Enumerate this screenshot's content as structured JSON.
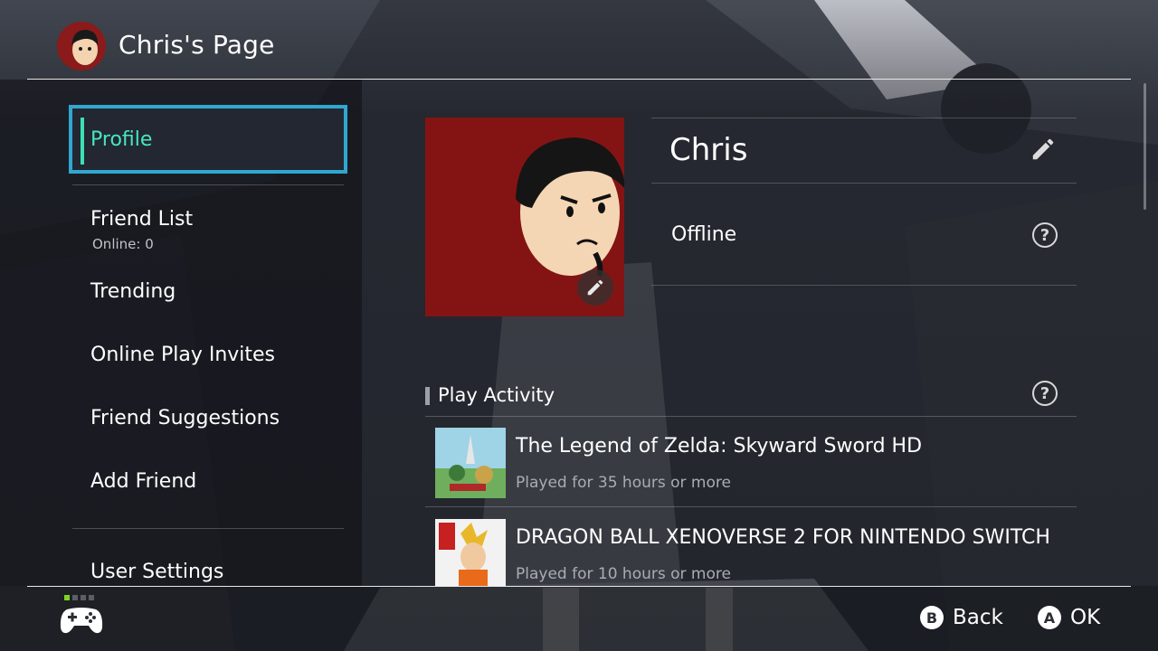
{
  "header": {
    "title": "Chris's Page"
  },
  "sidebar": {
    "items": [
      {
        "label": "Profile"
      },
      {
        "label": "Friend List",
        "sub": "Online: 0"
      },
      {
        "label": "Trending"
      },
      {
        "label": "Online Play Invites"
      },
      {
        "label": "Friend Suggestions"
      },
      {
        "label": "Add Friend"
      },
      {
        "label": "User Settings"
      }
    ]
  },
  "profile": {
    "name": "Chris",
    "status": "Offline",
    "edit_icon": "pencil-icon",
    "help_icon": "question-circle-icon",
    "avatar_bg": "#841414"
  },
  "activity": {
    "title": "Play Activity",
    "games": [
      {
        "title": "The Legend of Zelda: Skyward Sword HD",
        "time": "Played for 35 hours or more"
      },
      {
        "title": "DRAGON BALL XENOVERSE 2 FOR NINTENDO SWITCH",
        "time": "Played for 10 hours or more"
      }
    ]
  },
  "footer": {
    "back": {
      "key": "B",
      "label": "Back"
    },
    "ok": {
      "key": "A",
      "label": "OK"
    }
  },
  "colors": {
    "accent": "#30a6d0",
    "selected_text": "#46e6c0",
    "indicator": "#7ed321"
  }
}
